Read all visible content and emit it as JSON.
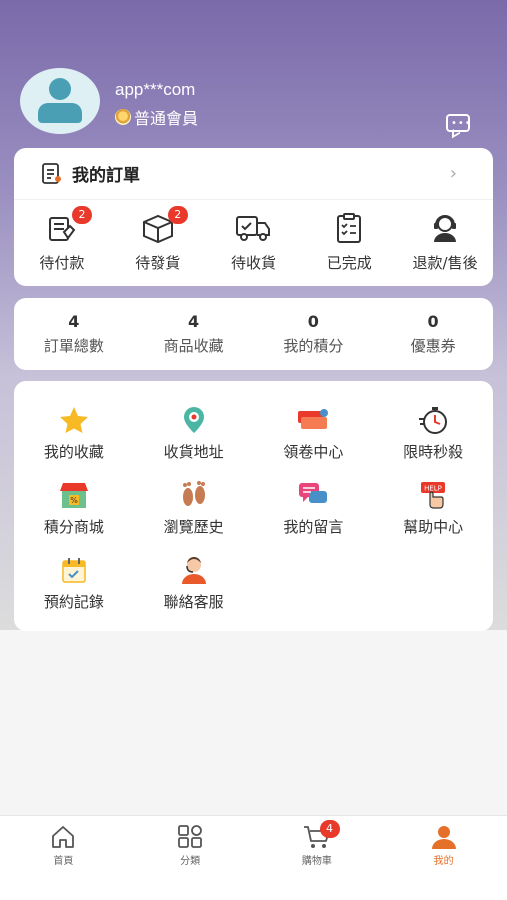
{
  "profile": {
    "username": "app***com",
    "member_level": "普通會員"
  },
  "orders": {
    "title": "我的訂單",
    "items": [
      {
        "label": "待付款",
        "badge": "2",
        "icon": "payment-icon"
      },
      {
        "label": "待發貨",
        "badge": "2",
        "icon": "package-icon"
      },
      {
        "label": "待收貨",
        "badge": "",
        "icon": "delivery-truck-icon"
      },
      {
        "label": "已完成",
        "badge": "",
        "icon": "clipboard-check-icon"
      },
      {
        "label": "退款/售後",
        "badge": "",
        "icon": "customer-service-icon"
      }
    ]
  },
  "stats": [
    {
      "value": "4",
      "label": "訂單總數"
    },
    {
      "value": "4",
      "label": "商品收藏"
    },
    {
      "value": "0",
      "label": "我的積分"
    },
    {
      "value": "0",
      "label": "優惠券"
    }
  ],
  "services": [
    {
      "label": "我的收藏",
      "icon": "star-icon"
    },
    {
      "label": "收貨地址",
      "icon": "location-pin-icon"
    },
    {
      "label": "領卷中心",
      "icon": "coupon-icon"
    },
    {
      "label": "限時秒殺",
      "icon": "stopwatch-icon"
    },
    {
      "label": "積分商城",
      "icon": "store-icon"
    },
    {
      "label": "瀏覽歷史",
      "icon": "footprints-icon"
    },
    {
      "label": "我的留言",
      "icon": "chat-bubbles-icon"
    },
    {
      "label": "幫助中心",
      "icon": "help-sign-icon"
    },
    {
      "label": "預約記錄",
      "icon": "calendar-icon"
    },
    {
      "label": "聯絡客服",
      "icon": "agent-icon"
    }
  ],
  "tabbar": [
    {
      "label": "首頁",
      "icon": "home-icon"
    },
    {
      "label": "分類",
      "icon": "category-grid-icon"
    },
    {
      "label": "購物車",
      "icon": "cart-icon",
      "badge": "4"
    },
    {
      "label": "我的",
      "icon": "user-icon",
      "active": true
    }
  ],
  "colors": {
    "accent": "#e5702a",
    "badge": "#e8392a",
    "header_gradient_top": "#7a6aaa"
  }
}
